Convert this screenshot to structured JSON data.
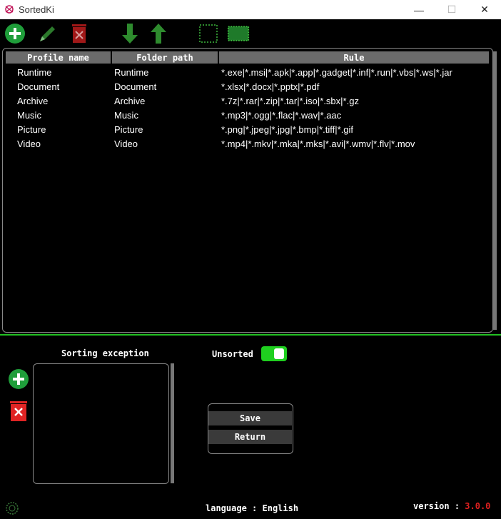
{
  "window": {
    "title": "SortedKi",
    "minimize": "—",
    "maximize": "☐",
    "close": "✕"
  },
  "table": {
    "headers": [
      "Profile name",
      "Folder path",
      "Rule"
    ],
    "rows": [
      [
        "Runtime",
        "Runtime",
        "*.exe|*.msi|*.apk|*.app|*.gadget|*.inf|*.run|*.vbs|*.ws|*.jar"
      ],
      [
        "Document",
        "Document",
        "*.xlsx|*.docx|*.pptx|*.pdf"
      ],
      [
        "Archive",
        "Archive",
        "*.7z|*.rar|*.zip|*.tar|*.iso|*.sbx|*.gz"
      ],
      [
        "Music",
        "Music",
        "*.mp3|*.ogg|*.flac|*.wav|*.aac"
      ],
      [
        "Picture",
        "Picture",
        "*.png|*.jpeg|*.jpg|*.bmp|*.tiff|*.gif"
      ],
      [
        "Video",
        "Video",
        "*.mp4|*.mkv|*.mka|*.mks|*.avi|*.wmv|*.flv|*.mov"
      ]
    ]
  },
  "exceptions": {
    "title": "Sorting exception"
  },
  "unsorted": {
    "label": "Unsorted",
    "enabled": true
  },
  "actions": {
    "save": "Save",
    "return": "Return"
  },
  "footer": {
    "language_label": "language",
    "language_sep": ":",
    "language_value": "English",
    "version_label": "version",
    "version_sep": ":",
    "version_value": "3.0.0"
  },
  "colors": {
    "accent": "#22c022",
    "danger": "#cc1f1f",
    "header_bg": "#6b6b6b"
  }
}
